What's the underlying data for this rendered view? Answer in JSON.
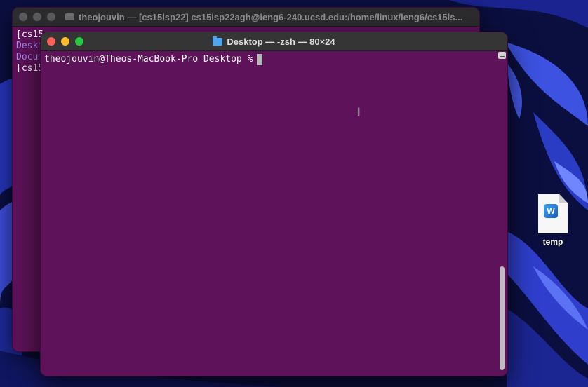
{
  "back_window": {
    "title": "theojouvin — [cs15lsp22]  cs15lsp22agh@ieng6-240.ucsd.edu:/home/linux/ieng6/cs15ls...",
    "lines": [
      {
        "text": "[cs15",
        "style": "white"
      },
      {
        "text": "Deskt",
        "style": "purple"
      },
      {
        "text": "Docum",
        "style": "purple"
      },
      {
        "text": "[cs15",
        "style": "white"
      }
    ]
  },
  "front_window": {
    "title": "Desktop — -zsh — 80×24",
    "prompt": "theojouvin@Theos-MacBook-Pro Desktop %"
  },
  "desktop": {
    "file_name": "temp",
    "file_badge": "W"
  },
  "colors": {
    "terminal_bg": "#5d1259",
    "accent_purple_text": "#a98bf0",
    "folder_blue": "#4ea5f2"
  },
  "icons": [
    "folder-icon",
    "word-document-icon",
    "text-cursor-icon"
  ]
}
